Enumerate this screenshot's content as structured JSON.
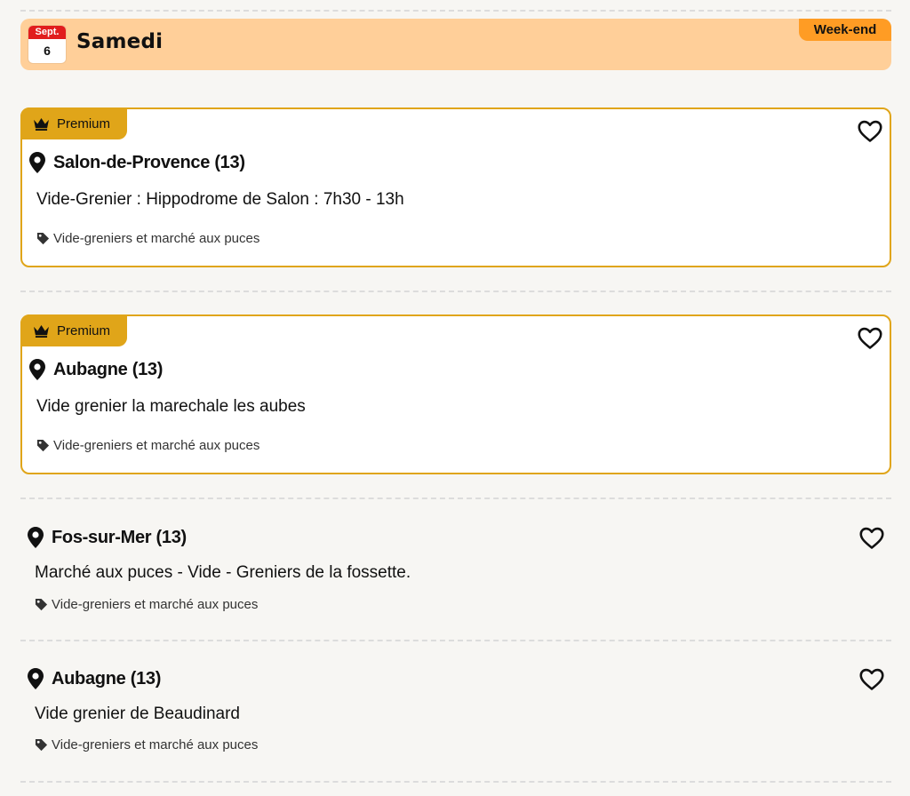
{
  "day": {
    "month": "Sept.",
    "day_number": "6",
    "title": "Samedi",
    "badge": "Week-end"
  },
  "colors": {
    "header_bg": "#ffcf99",
    "weekend_badge": "#ff9c24",
    "premium_gold": "#e0a519",
    "calendar_red": "#e11d1d",
    "page_bg": "#f7f6f3"
  },
  "events": [
    {
      "premium": true,
      "premium_label": "Premium",
      "location": "Salon-de-Provence (13)",
      "title": "Vide-Grenier : Hippodrome de Salon : 7h30 - 13h",
      "category": "Vide-greniers et marché aux puces",
      "icons": [
        "crown-icon",
        "map-pin-icon",
        "heart-icon",
        "tag-icon"
      ]
    },
    {
      "premium": true,
      "premium_label": "Premium",
      "location": "Aubagne (13)",
      "title": "Vide grenier la marechale les aubes",
      "category": "Vide-greniers et marché aux puces",
      "icons": [
        "crown-icon",
        "map-pin-icon",
        "heart-icon",
        "tag-icon"
      ]
    },
    {
      "premium": false,
      "location": "Fos-sur-Mer (13)",
      "title": "Marché aux puces - Vide - Greniers de la fossette.",
      "category": "Vide-greniers et marché aux puces",
      "icons": [
        "map-pin-icon",
        "heart-icon",
        "tag-icon"
      ]
    },
    {
      "premium": false,
      "location": "Aubagne (13)",
      "title": "Vide grenier de Beaudinard",
      "category": "Vide-greniers et marché aux puces",
      "icons": [
        "map-pin-icon",
        "heart-icon",
        "tag-icon"
      ]
    }
  ]
}
